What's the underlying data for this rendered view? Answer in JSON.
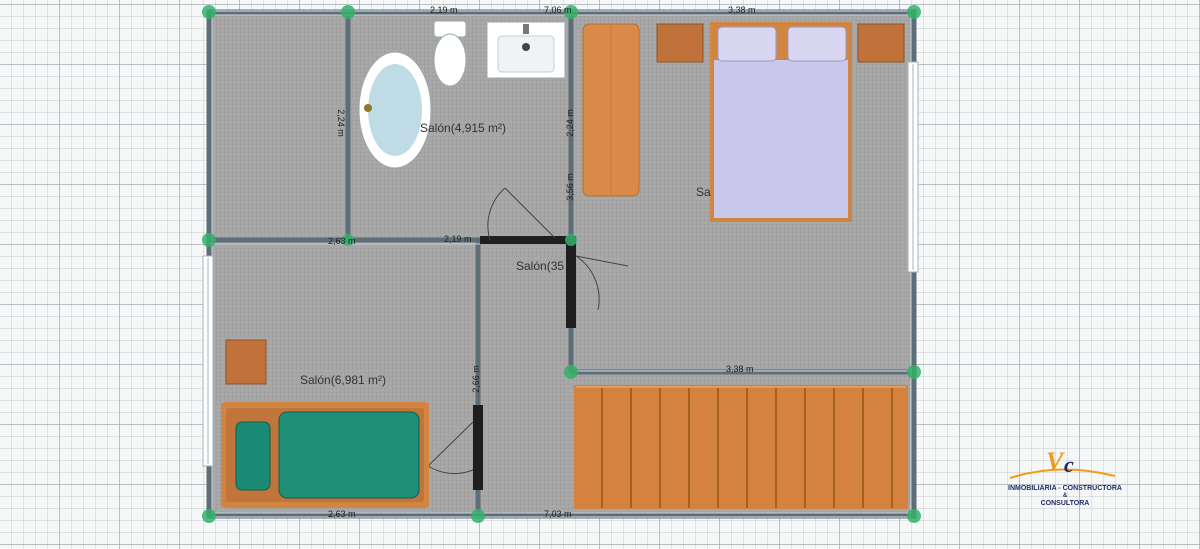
{
  "rooms": [
    {
      "id": "bath",
      "label": "Salón(4,915 m²)"
    },
    {
      "id": "bed",
      "label": "Salón(6,981 m²)"
    },
    {
      "id": "hall",
      "label": "Salón(35"
    },
    {
      "id": "master",
      "label": "Sa"
    }
  ],
  "dimensions": {
    "top_a": "2,19 m",
    "top_b": "7,06 m",
    "top_c": "3,38 m",
    "mid_a": "2,63 m",
    "mid_b": "2,19 m",
    "mid_c": "3,38 m",
    "bot_a": "2,63 m",
    "bot_b": "7,03 m",
    "v_a": "2,24 m",
    "v_b": "2,24 m",
    "v_c": "3,56 m",
    "v_d": "2,66 m"
  },
  "brand": {
    "line1": "INMOBILIARIA - CONSTRUCTORA",
    "line2": "&",
    "line3": "CONSULTORA",
    "colors": {
      "navy": "#1f2a6b",
      "orange": "#f29a1d"
    }
  },
  "colors": {
    "floor": "#a9a9a9",
    "wall": "#5f6f78",
    "node": "#3fb06a",
    "wood": "#d2823f",
    "teal": "#1f8f7a",
    "bedding": "#c8c6e6"
  }
}
